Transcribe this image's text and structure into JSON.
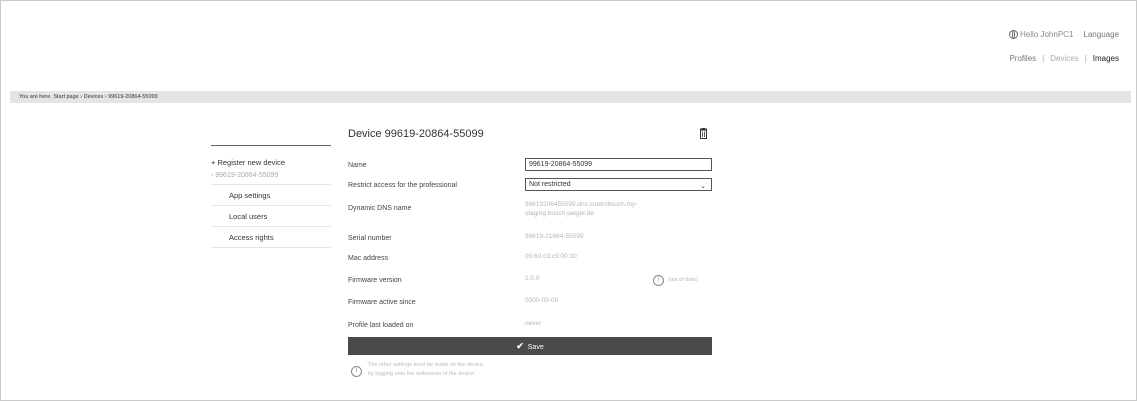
{
  "header": {
    "user_greeting": "Hello JohnPC1",
    "language_label": "Language",
    "nav": {
      "profiles": "Profiles",
      "devices": "Devices",
      "images": "Images"
    }
  },
  "breadcrumb": {
    "prefix": "You are here",
    "items": [
      "Start page",
      "Devices",
      "99619-20864-55099"
    ]
  },
  "sidebar": {
    "register": "+ Register new device",
    "device": "› 99619-20864-55099",
    "items": [
      {
        "label": "App settings"
      },
      {
        "label": "Local users"
      },
      {
        "label": "Access rights"
      }
    ]
  },
  "device": {
    "title": "Device 99619-20864-55099",
    "fields": {
      "name_label": "Name",
      "name_value": "99619-20864-55099",
      "restrict_label": "Restrict access for the professional",
      "restrict_value": "Not restricted",
      "ddns_label": "Dynamic DNS name",
      "ddns_value_1": "99619206455099.dns.controllouch.my-",
      "ddns_value_2": "staging.busch-jaeger.de",
      "serial_label": "Serial number",
      "serial_value": "99619-21864-55099",
      "mac_label": "Mac address",
      "mac_value": "00:60:c3:c9:00:30",
      "firmware_label": "Firmware version",
      "firmware_value": "1.0.0",
      "firmware_status": "(out of date)",
      "active_since_label": "Firmware active since",
      "active_since_value": "0000-00-00",
      "profile_label": "Profile last loaded on",
      "profile_value": "never"
    },
    "save_label": "Save",
    "footnote_1": "The other settings must be made on the device,",
    "footnote_2": "by logging onto the webserver of the device."
  }
}
